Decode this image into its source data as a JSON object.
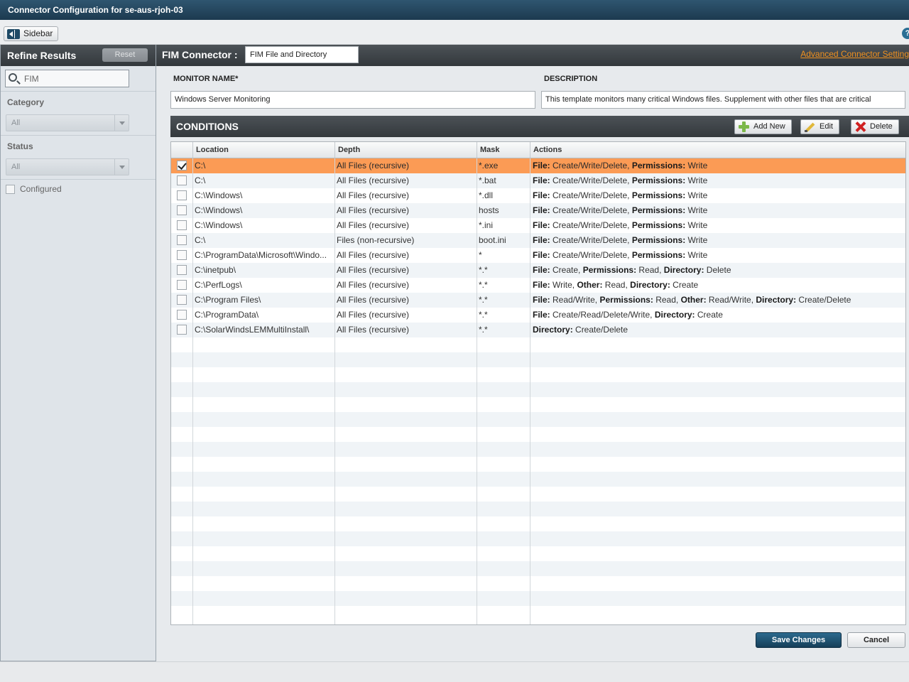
{
  "window": {
    "title": "Connector Configuration for se-aus-rjoh-03"
  },
  "toolbar": {
    "sidebar_label": "Sidebar",
    "help_symbol": "?"
  },
  "sidebar": {
    "title": "Refine Results",
    "reset_label": "Reset",
    "search_value": "FIM",
    "category_label": "Category",
    "category_value": "All",
    "status_label": "Status",
    "status_value": "All",
    "configured_label": "Configured"
  },
  "connector": {
    "label": "FIM Connector :",
    "value": "FIM File and Directory",
    "advanced_link": "Advanced Connector Settings"
  },
  "form": {
    "monitor_name_label": "MONITOR NAME*",
    "monitor_name_value": "Windows Server Monitoring",
    "description_label": "DESCRIPTION",
    "description_value": "This template monitors many critical Windows files.  Supplement with other files that are critical"
  },
  "conditions": {
    "title": "CONDITIONS",
    "add_label": "Add New",
    "edit_label": "Edit",
    "delete_label": "Delete",
    "columns": [
      "Location",
      "Depth",
      "Mask",
      "Actions"
    ],
    "rows": [
      {
        "checked": true,
        "location": "C:\\",
        "depth": "All Files (recursive)",
        "mask": "*.exe",
        "actions": [
          [
            "File:",
            " Create/Write/Delete, "
          ],
          [
            "Permissions:",
            " Write"
          ]
        ]
      },
      {
        "checked": false,
        "location": "C:\\",
        "depth": "All Files (recursive)",
        "mask": "*.bat",
        "actions": [
          [
            "File:",
            " Create/Write/Delete, "
          ],
          [
            "Permissions:",
            " Write"
          ]
        ]
      },
      {
        "checked": false,
        "location": "C:\\Windows\\",
        "depth": "All Files (recursive)",
        "mask": "*.dll",
        "actions": [
          [
            "File:",
            " Create/Write/Delete, "
          ],
          [
            "Permissions:",
            " Write"
          ]
        ]
      },
      {
        "checked": false,
        "location": "C:\\Windows\\",
        "depth": "All Files (recursive)",
        "mask": "hosts",
        "actions": [
          [
            "File:",
            " Create/Write/Delete, "
          ],
          [
            "Permissions:",
            " Write"
          ]
        ]
      },
      {
        "checked": false,
        "location": "C:\\Windows\\",
        "depth": "All Files (recursive)",
        "mask": "*.ini",
        "actions": [
          [
            "File:",
            " Create/Write/Delete, "
          ],
          [
            "Permissions:",
            " Write"
          ]
        ]
      },
      {
        "checked": false,
        "location": "C:\\",
        "depth": "Files (non-recursive)",
        "mask": "boot.ini",
        "actions": [
          [
            "File:",
            " Create/Write/Delete, "
          ],
          [
            "Permissions:",
            " Write"
          ]
        ]
      },
      {
        "checked": false,
        "location": "C:\\ProgramData\\Microsoft\\Windo...",
        "depth": "All Files (recursive)",
        "mask": "*",
        "actions": [
          [
            "File:",
            " Create/Write/Delete, "
          ],
          [
            "Permissions:",
            " Write"
          ]
        ]
      },
      {
        "checked": false,
        "location": "C:\\inetpub\\",
        "depth": "All Files (recursive)",
        "mask": "*.*",
        "actions": [
          [
            "File:",
            " Create, "
          ],
          [
            "Permissions:",
            " Read, "
          ],
          [
            "Directory:",
            " Delete"
          ]
        ]
      },
      {
        "checked": false,
        "location": "C:\\PerfLogs\\",
        "depth": "All Files (recursive)",
        "mask": "*.*",
        "actions": [
          [
            "File:",
            " Write, "
          ],
          [
            "Other:",
            " Read, "
          ],
          [
            "Directory:",
            " Create"
          ]
        ]
      },
      {
        "checked": false,
        "location": "C:\\Program Files\\",
        "depth": "All Files (recursive)",
        "mask": "*.*",
        "actions": [
          [
            "File:",
            " Read/Write, "
          ],
          [
            "Permissions:",
            " Read, "
          ],
          [
            "Other:",
            " Read/Write, "
          ],
          [
            "Directory:",
            " Create/Delete"
          ]
        ]
      },
      {
        "checked": false,
        "location": "C:\\ProgramData\\",
        "depth": "All Files (recursive)",
        "mask": "*.*",
        "actions": [
          [
            "File:",
            " Create/Read/Delete/Write, "
          ],
          [
            "Directory:",
            " Create"
          ]
        ]
      },
      {
        "checked": false,
        "location": "C:\\SolarWindsLEMMultiInstall\\",
        "depth": "All Files (recursive)",
        "mask": "*.*",
        "actions": [
          [
            "Directory:",
            " Create/Delete"
          ]
        ]
      }
    ]
  },
  "footer": {
    "save_label": "Save Changes",
    "cancel_label": "Cancel"
  }
}
